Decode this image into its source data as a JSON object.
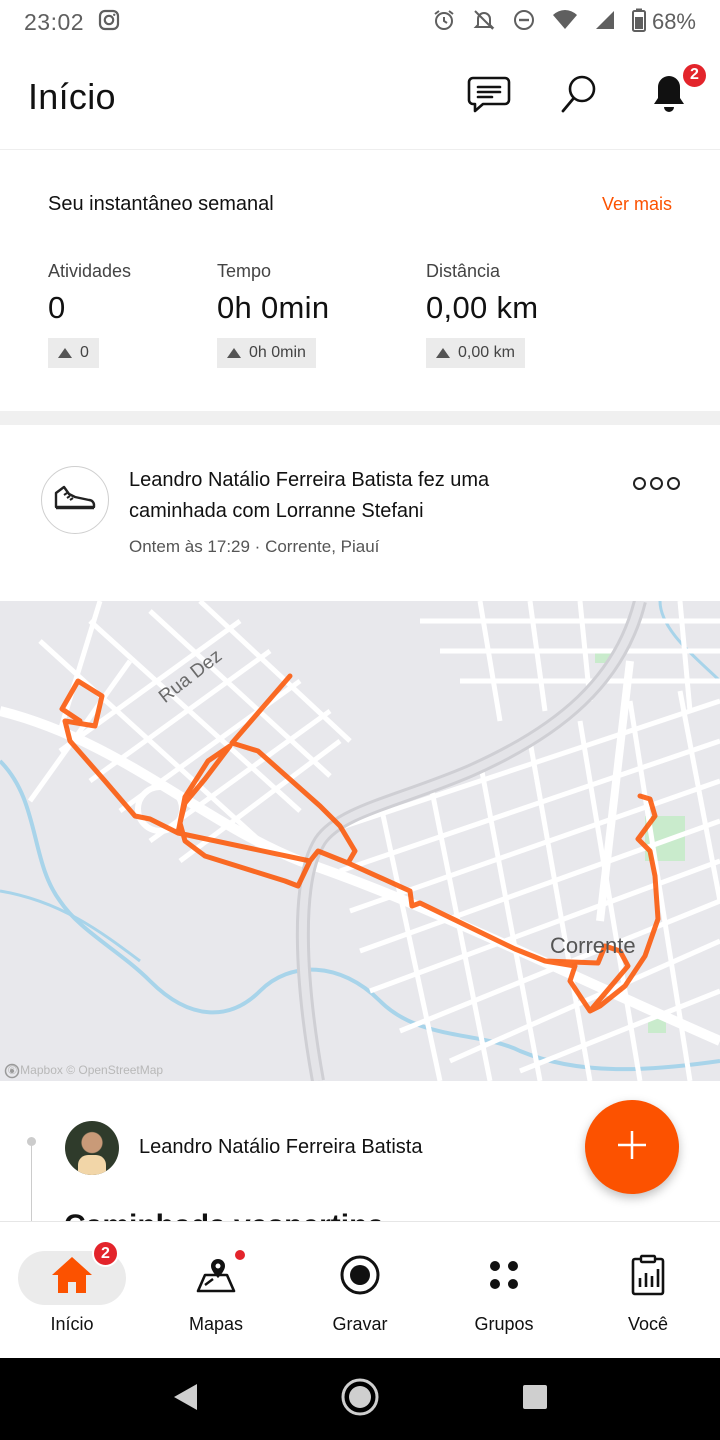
{
  "status_bar": {
    "time": "23:02",
    "battery": "68%",
    "icons": [
      "instagram-icon",
      "alarm-icon",
      "notifications-off-icon",
      "do-not-disturb-icon",
      "wifi-icon",
      "signal-icon",
      "battery-icon"
    ]
  },
  "header": {
    "title": "Início",
    "notifications_badge": "2",
    "icons": [
      "messages-icon",
      "search-icon",
      "bell-icon"
    ]
  },
  "snapshot": {
    "title": "Seu instantâneo semanal",
    "more_link": "Ver mais",
    "stats": [
      {
        "label": "Atividades",
        "value": "0",
        "delta": "0"
      },
      {
        "label": "Tempo",
        "value": "0h 0min",
        "delta": "0h 0min"
      },
      {
        "label": "Distância",
        "value": "0,00 km",
        "delta": "0,00 km"
      }
    ]
  },
  "activity": {
    "title": "Leandro Natálio Ferreira Batista fez uma caminhada com Lorranne Stefani",
    "meta": "Ontem às 17:29 · Corrente, Piauí",
    "icon": "walking-shoe-icon"
  },
  "map": {
    "street_label": "Rua Dez",
    "city_label": "Corrente",
    "attribution": "© Mapbox © OpenStreetMap",
    "route_color": "#fc5200"
  },
  "post": {
    "author": "Leandro Natálio Ferreira Batista",
    "title_partial": "Caminhada vespertina"
  },
  "fab": {
    "icon": "plus-icon"
  },
  "bottom_nav": [
    {
      "label": "Início",
      "icon": "home-icon",
      "badge": "2",
      "active": true
    },
    {
      "label": "Mapas",
      "icon": "maps-icon",
      "active": false
    },
    {
      "label": "Gravar",
      "icon": "record-icon",
      "active": false
    },
    {
      "label": "Grupos",
      "icon": "groups-icon",
      "active": false
    },
    {
      "label": "Você",
      "icon": "profile-icon",
      "active": false
    }
  ],
  "colors": {
    "accent": "#fc5200",
    "badge": "#e3242b"
  }
}
